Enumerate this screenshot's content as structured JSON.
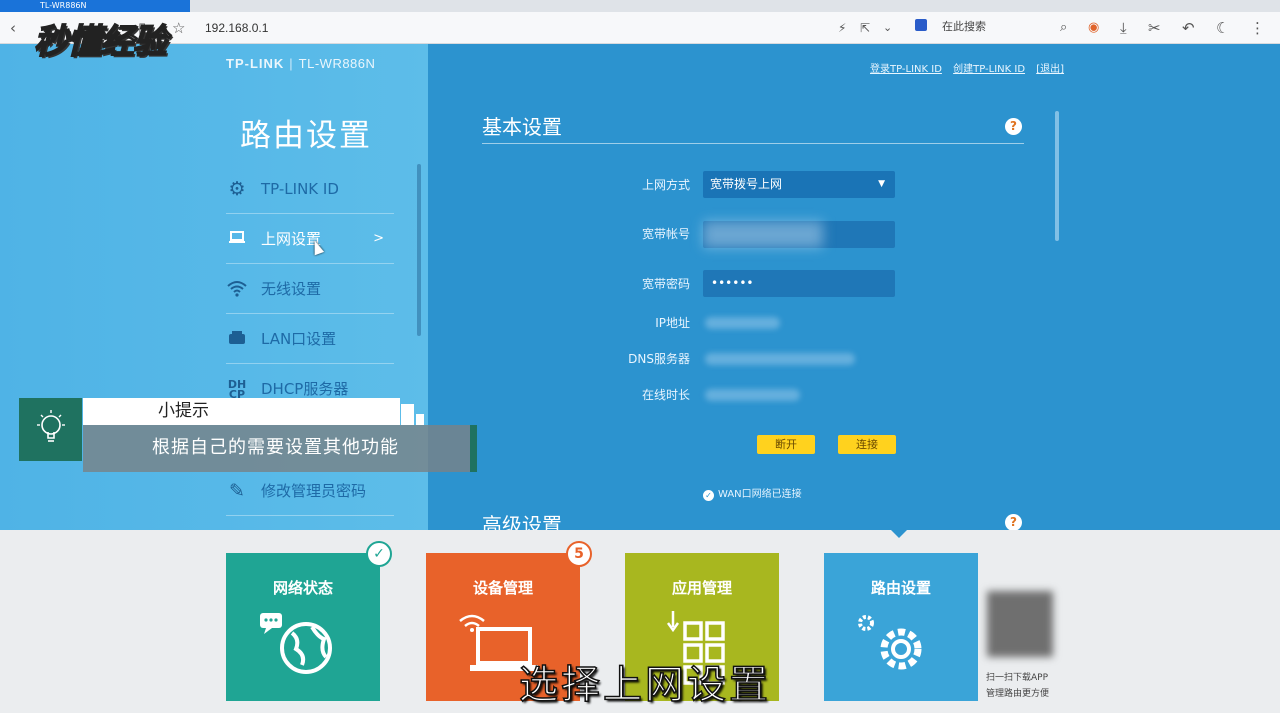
{
  "browser": {
    "tab_title": "TL-WR886N",
    "address": "192.168.0.1",
    "search_placeholder": "在此搜索"
  },
  "watermark": "秒懂经验",
  "router": {
    "brand": "TP-LINK",
    "model": "TL-WR886N",
    "account_links": [
      "登录TP-LINK ID",
      "创建TP-LINK ID",
      "[退出]"
    ],
    "section_title": "路由设置",
    "nav": [
      {
        "label": "TP-LINK ID",
        "icon": "gear-icon"
      },
      {
        "label": "上网设置",
        "icon": "laptop-icon",
        "active": true,
        "chevron": ">"
      },
      {
        "label": "无线设置",
        "icon": "wifi-icon"
      },
      {
        "label": "LAN口设置",
        "icon": "lan-icon"
      },
      {
        "label": "DHCP服务器",
        "icon": "dhcp-icon"
      },
      {
        "label": "修改管理员密码",
        "icon": "pencil-icon"
      }
    ],
    "basic": {
      "title": "基本设置",
      "help": "?",
      "labels": {
        "connection": "上网方式",
        "account": "宽带帐号",
        "password": "宽带密码",
        "ip": "IP地址",
        "dns": "DNS服务器",
        "uptime": "在线时长"
      },
      "connection_value": "宽带拨号上网",
      "password_value": "••••••",
      "disconnect": "断开",
      "connect": "连接",
      "wan_status": "WAN口网络已连接"
    },
    "advanced_title": "高级设置"
  },
  "tip": {
    "heading": "小提示",
    "body": "根据自己的需要设置其他功能"
  },
  "tiles": [
    {
      "label": "网络状态",
      "color": "#1fa594",
      "badge": "✓"
    },
    {
      "label": "设备管理",
      "color": "#e8622a",
      "badge": "5"
    },
    {
      "label": "应用管理",
      "color": "#a8b71f"
    },
    {
      "label": "路由设置",
      "color": "#3aa4d8"
    }
  ],
  "qr_text": [
    "扫一扫下载APP",
    "管理路由更方便"
  ],
  "subtitle": "选择上网设置"
}
